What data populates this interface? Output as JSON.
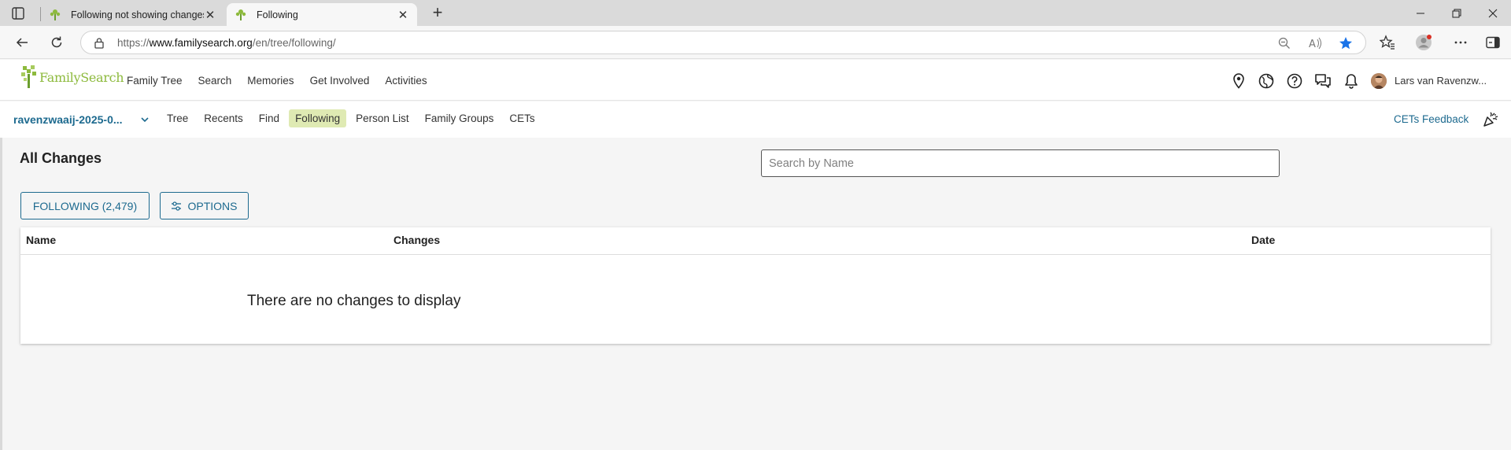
{
  "browser": {
    "tabs": [
      {
        "title": "Following not showing changes o",
        "active": false
      },
      {
        "title": "Following",
        "active": true
      }
    ],
    "url_prefix": "https://",
    "url_domain": "www.familysearch.org",
    "url_path": "/en/tree/following/",
    "new_tab_glyph": "+",
    "close_glyph": "✕",
    "icons": [
      "tab-actions-icon",
      "back-icon",
      "refresh-icon",
      "lock-icon",
      "zoom-icon",
      "read-aloud-icon",
      "favorite-star-icon",
      "favorites-icon",
      "profile-icon",
      "more-icon",
      "sidebar-icon"
    ]
  },
  "site": {
    "logo_text": "FamilySearch",
    "nav": [
      "Family Tree",
      "Search",
      "Memories",
      "Get Involved",
      "Activities"
    ],
    "user_name": "Lars van Ravenzw...",
    "header_icons": [
      "location-pin-icon",
      "globe-icon",
      "help-icon",
      "messages-icon",
      "bell-icon"
    ]
  },
  "subnav": {
    "tree_name": "ravenzwaaij-2025-0...",
    "items": [
      "Tree",
      "Recents",
      "Find",
      "Following",
      "Person List",
      "Family Groups",
      "CETs"
    ],
    "selected": "Following",
    "feedback": "CETs Feedback"
  },
  "content": {
    "title": "All Changes",
    "search_placeholder": "Search by Name",
    "following_button": "FOLLOWING (2,479)",
    "options_button": "OPTIONS",
    "columns": [
      "Name",
      "Changes",
      "Date"
    ],
    "empty_message": "There are no changes to display"
  },
  "colors": {
    "brand_green": "#8dba3d",
    "link_blue": "#1d6a8f",
    "selected_bg": "#dfeab3"
  }
}
